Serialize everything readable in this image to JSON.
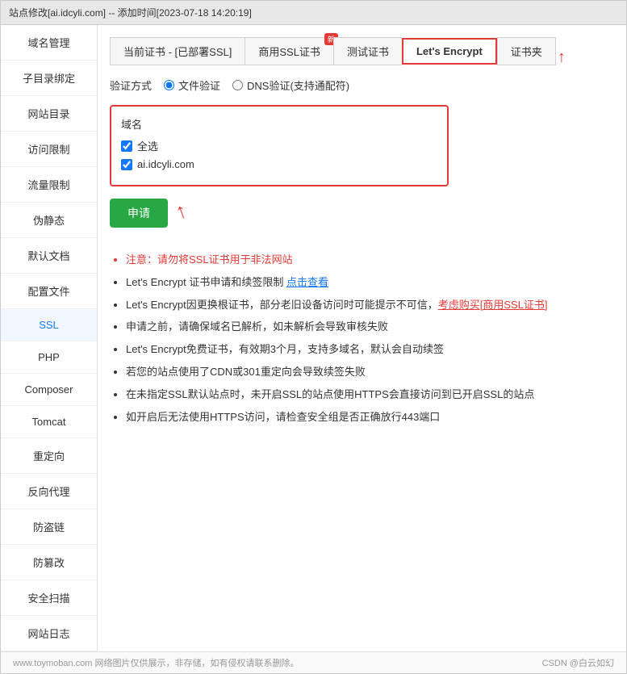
{
  "titlebar": "站点修改[ai.idcyli.com] -- 添加时间[2023-07-18 14:20:19]",
  "sidebar": {
    "items": [
      {
        "label": "域名管理",
        "active": false
      },
      {
        "label": "子目录绑定",
        "active": false
      },
      {
        "label": "网站目录",
        "active": false
      },
      {
        "label": "访问限制",
        "active": false
      },
      {
        "label": "流量限制",
        "active": false
      },
      {
        "label": "伪静态",
        "active": false
      },
      {
        "label": "默认文档",
        "active": false
      },
      {
        "label": "配置文件",
        "active": false
      },
      {
        "label": "SSL",
        "active": true
      },
      {
        "label": "PHP",
        "active": false
      },
      {
        "label": "Composer",
        "active": false
      },
      {
        "label": "Tomcat",
        "active": false
      },
      {
        "label": "重定向",
        "active": false
      },
      {
        "label": "反向代理",
        "active": false
      },
      {
        "label": "防盗链",
        "active": false
      },
      {
        "label": "防篡改",
        "active": false
      },
      {
        "label": "安全扫描",
        "active": false
      },
      {
        "label": "网站日志",
        "active": false
      }
    ]
  },
  "tabs": [
    {
      "label": "当前证书 - [已部署SSL]",
      "active": false,
      "badge": ""
    },
    {
      "label": "商用SSL证书",
      "active": false,
      "badge": "新"
    },
    {
      "label": "测试证书",
      "active": false,
      "badge": ""
    },
    {
      "label": "Let's Encrypt",
      "active": true,
      "badge": ""
    },
    {
      "label": "证书夹",
      "active": false,
      "badge": ""
    }
  ],
  "verify": {
    "label": "验证方式",
    "options": [
      {
        "label": "文件验证",
        "selected": true
      },
      {
        "label": "DNS验证(支持通配符)",
        "selected": false
      }
    ]
  },
  "domain_section": {
    "label": "域名",
    "select_all": "全选",
    "domain": "ai.idcyli.com"
  },
  "apply_button": "申请",
  "notes": [
    {
      "text": "注意：请勿将SSL证书用于非法网站",
      "style": "red"
    },
    {
      "text": "Let's Encrypt 证书申请和续签限制 点击查看",
      "style": "normal",
      "link": "点击查看"
    },
    {
      "text": "Let's Encrypt因更换根证书，部分老旧设备访问时可能提示不可信，考虑购买[商用SSL证书]",
      "style": "red-partial"
    },
    {
      "text": "申请之前，请确保域名已解析，如未解析会导致审核失败",
      "style": "normal"
    },
    {
      "text": "Let's Encrypt免费证书，有效期3个月，支持多域名，默认会自动续签",
      "style": "normal"
    },
    {
      "text": "若您的站点使用了CDN或301重定向会导致续签失败",
      "style": "normal"
    },
    {
      "text": "在未指定SSL默认站点时，未开启SSL的站点使用HTTPS会直接访问到已开启SSL的站点",
      "style": "normal"
    },
    {
      "text": "如开启后无法使用HTTPS访问，请检查安全组是否正确放行443端口",
      "style": "normal"
    }
  ],
  "footer": {
    "left": "www.toymoban.com 网络图片仅供展示，非存储，如有侵权请联系删除。",
    "right": "CSDN @白云如幻"
  }
}
